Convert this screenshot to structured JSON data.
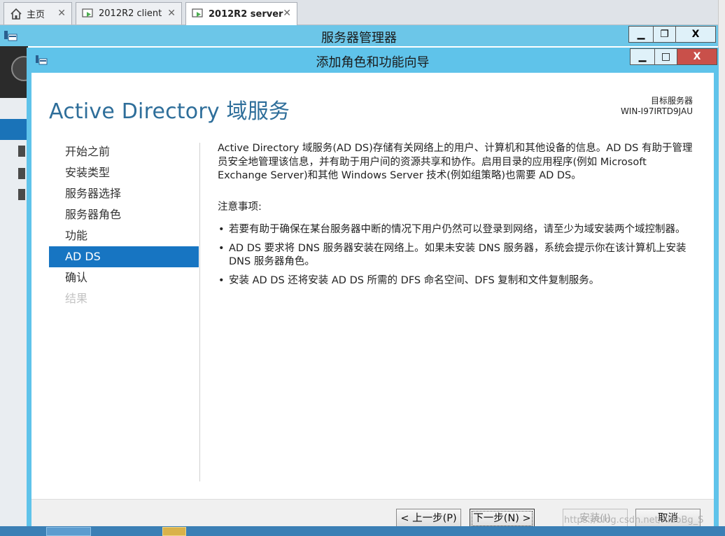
{
  "host_tabs": [
    {
      "label": "主页",
      "icon": "home-icon"
    },
    {
      "label": "2012R2 client",
      "icon": "vm-icon"
    },
    {
      "label": "2012R2 server",
      "icon": "vm-icon",
      "active": true
    }
  ],
  "server_manager": {
    "title": "服务器管理器",
    "minimize": "▁",
    "restore": "❐",
    "close": "X"
  },
  "wizard": {
    "title": "添加角色和功能向导",
    "minimize": "▁",
    "maximize": "□",
    "close": "X",
    "page_title": "Active Directory 域服务",
    "target_label": "目标服务器",
    "target_value": "WIN-I97IRTD9JAU",
    "nav": [
      {
        "label": "开始之前",
        "state": "normal"
      },
      {
        "label": "安装类型",
        "state": "normal"
      },
      {
        "label": "服务器选择",
        "state": "normal"
      },
      {
        "label": "服务器角色",
        "state": "normal"
      },
      {
        "label": "功能",
        "state": "normal"
      },
      {
        "label": "AD DS",
        "state": "selected"
      },
      {
        "label": "确认",
        "state": "normal"
      },
      {
        "label": "结果",
        "state": "disabled"
      }
    ],
    "description": "Active Directory 域服务(AD DS)存储有关网络上的用户、计算机和其他设备的信息。AD DS 有助于管理员安全地管理该信息，并有助于用户间的资源共享和协作。启用目录的应用程序(例如 Microsoft Exchange Server)和其他 Windows Server 技术(例如组策略)也需要 AD DS。",
    "notes_heading": "注意事项:",
    "notes": [
      "若要有助于确保在某台服务器中断的情况下用户仍然可以登录到网络，请至少为域安装两个域控制器。",
      "AD DS 要求将 DNS 服务器安装在网络上。如果未安装 DNS 服务器，系统会提示你在该计算机上安装 DNS 服务器角色。",
      "安装 AD DS 还将安装 AD DS 所需的 DFS 命名空间、DFS 复制和文件复制服务。"
    ],
    "buttons": {
      "previous": "< 上一步(P)",
      "next": "下一步(N) >",
      "install": "安装(I)",
      "cancel": "取消"
    }
  },
  "watermark": "https://blog.csdn.net/XiaoBg_S",
  "colors": {
    "titlebar": "#6cc6e8",
    "accent": "#1775c2",
    "page_title": "#2e6e9a",
    "close_button": "#c9504a"
  }
}
